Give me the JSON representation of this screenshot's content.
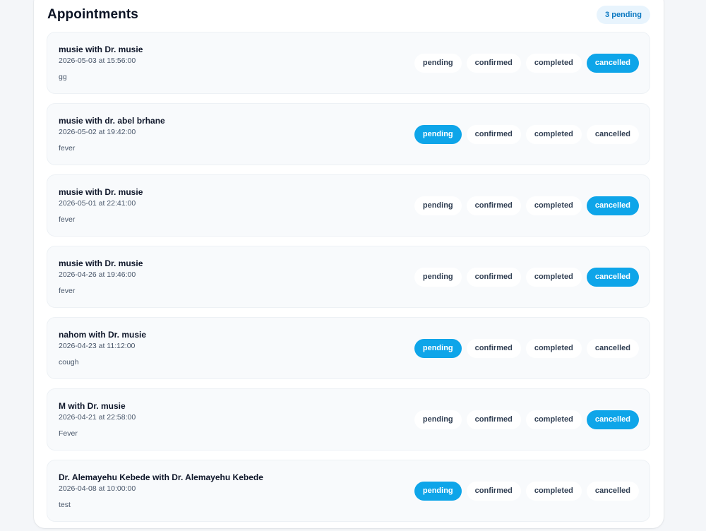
{
  "header": {
    "title": "Appointments",
    "badge": "3 pending"
  },
  "status_options": [
    "pending",
    "confirmed",
    "completed",
    "cancelled"
  ],
  "colors": {
    "accent": "#0ea5e9",
    "badge_bg": "#e8f4fd",
    "badge_text": "#0c79c2"
  },
  "appointments": [
    {
      "title": "musie with Dr. musie",
      "datetime": "2026-05-03 at 15:56:00",
      "note": "gg",
      "status": "cancelled"
    },
    {
      "title": "musie with dr. abel brhane",
      "datetime": "2026-05-02 at 19:42:00",
      "note": "fever",
      "status": "pending"
    },
    {
      "title": "musie with Dr. musie",
      "datetime": "2026-05-01 at 22:41:00",
      "note": "fever",
      "status": "cancelled"
    },
    {
      "title": "musie with Dr. musie",
      "datetime": "2026-04-26 at 19:46:00",
      "note": "fever",
      "status": "cancelled"
    },
    {
      "title": "nahom with Dr. musie",
      "datetime": "2026-04-23 at 11:12:00",
      "note": "cough",
      "status": "pending"
    },
    {
      "title": "M with Dr. musie",
      "datetime": "2026-04-21 at 22:58:00",
      "note": "Fever",
      "status": "cancelled"
    },
    {
      "title": "Dr. Alemayehu Kebede with Dr. Alemayehu Kebede",
      "datetime": "2026-04-08 at 10:00:00",
      "note": "test",
      "status": "pending"
    }
  ]
}
